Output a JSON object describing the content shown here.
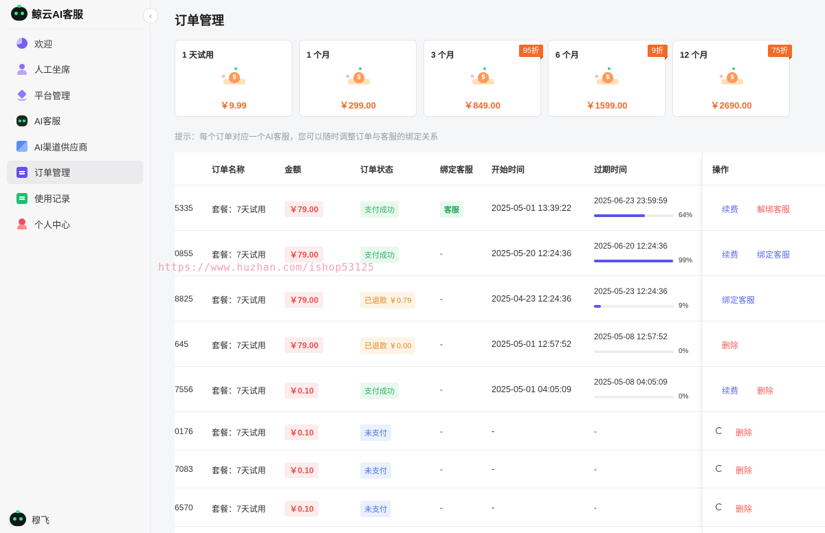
{
  "app": {
    "name": "鲸云AI客服"
  },
  "sidebar": {
    "items": [
      {
        "label": "欢迎",
        "icon": "pie-chart-icon",
        "active": false
      },
      {
        "label": "人工坐席",
        "icon": "user-icon",
        "active": false
      },
      {
        "label": "平台管理",
        "icon": "layers-icon",
        "active": false
      },
      {
        "label": "AI客服",
        "icon": "robot-icon",
        "active": false
      },
      {
        "label": "AI渠道供应商",
        "icon": "cube-icon",
        "active": false
      },
      {
        "label": "订单管理",
        "icon": "order-icon",
        "active": true
      },
      {
        "label": "使用记录",
        "icon": "record-icon",
        "active": false
      },
      {
        "label": "个人中心",
        "icon": "person-icon",
        "active": false
      }
    ],
    "user": {
      "name": "穆飞"
    }
  },
  "page": {
    "title": "订单管理"
  },
  "plans": [
    {
      "name": "1 天试用",
      "price": "￥9.99",
      "discount": ""
    },
    {
      "name": "1 个月",
      "price": "￥299.00",
      "discount": ""
    },
    {
      "name": "3 个月",
      "price": "￥849.00",
      "discount": "95折"
    },
    {
      "name": "6 个月",
      "price": "￥1599.00",
      "discount": "9折"
    },
    {
      "name": "12 个月",
      "price": "￥2690.00",
      "discount": "75折"
    }
  ],
  "tip": "提示：每个订单对应一个AI客服，您可以随时调整订单与客服的绑定关系",
  "table": {
    "headers": {
      "name": "订单名称",
      "amount": "金额",
      "status": "订单状态",
      "bound": "绑定客服",
      "start": "开始时间",
      "expire": "过期时间",
      "ops": "操作"
    },
    "rows": [
      {
        "id": "5335",
        "name": "套餐：7天试用",
        "amount": "￥79.00",
        "status": "支付成功",
        "status_type": "success",
        "bound": "客服",
        "start": "2025-05-01 13:39:22",
        "expire": "2025-06-23 23:59:59",
        "progress": 64,
        "progress_label": "64%",
        "actions": [
          "续费",
          "解绑客服"
        ],
        "spinner": false
      },
      {
        "id": "0855",
        "name": "套餐：7天试用",
        "amount": "￥79.00",
        "status": "支付成功",
        "status_type": "success",
        "bound": "-",
        "start": "2025-05-20 12:24:36",
        "expire": "2025-06-20 12:24:36",
        "progress": 99,
        "progress_label": "99%",
        "actions": [
          "续费",
          "绑定客服"
        ],
        "spinner": false
      },
      {
        "id": "8825",
        "name": "套餐：7天试用",
        "amount": "￥79.00",
        "status": "已退款 ￥0.79",
        "status_type": "refund",
        "bound": "-",
        "start": "2025-04-23 12:24:36",
        "expire": "2025-05-23 12:24:36",
        "progress": 9,
        "progress_label": "9%",
        "actions": [
          "绑定客服"
        ],
        "spinner": false
      },
      {
        "id": "645",
        "name": "套餐：7天试用",
        "amount": "￥79.00",
        "status": "已退款 ￥0.00",
        "status_type": "refund",
        "bound": "-",
        "start": "2025-05-01 12:57:52",
        "expire": "2025-05-08 12:57:52",
        "progress": 0,
        "progress_label": "0%",
        "actions": [
          "删除"
        ],
        "spinner": false
      },
      {
        "id": "7556",
        "name": "套餐：7天试用",
        "amount": "￥0.10",
        "status": "支付成功",
        "status_type": "success",
        "bound": "-",
        "start": "2025-05-01 04:05:09",
        "expire": "2025-05-08 04:05:09",
        "progress": 0,
        "progress_label": "0%",
        "actions": [
          "续费",
          "删除"
        ],
        "spinner": false
      },
      {
        "id": "0176",
        "name": "套餐：7天试用",
        "amount": "￥0.10",
        "status": "未支付",
        "status_type": "unpaid",
        "bound": "-",
        "start": "-",
        "expire": "-",
        "progress": null,
        "progress_label": "",
        "actions": [
          "删除"
        ],
        "spinner": true
      },
      {
        "id": "7083",
        "name": "套餐：7天试用",
        "amount": "￥0.10",
        "status": "未支付",
        "status_type": "unpaid",
        "bound": "-",
        "start": "-",
        "expire": "-",
        "progress": null,
        "progress_label": "",
        "actions": [
          "删除"
        ],
        "spinner": true
      },
      {
        "id": "6570",
        "name": "套餐：7天试用",
        "amount": "￥0.10",
        "status": "未支付",
        "status_type": "unpaid",
        "bound": "-",
        "start": "-",
        "expire": "-",
        "progress": null,
        "progress_label": "",
        "actions": [
          "删除"
        ],
        "spinner": true
      }
    ]
  },
  "watermark": "https://www.huzhan.com/ishop53125"
}
